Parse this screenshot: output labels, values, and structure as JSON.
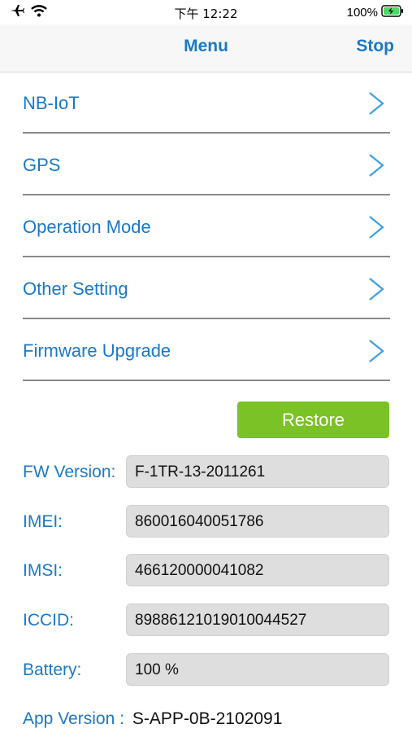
{
  "status_bar": {
    "time": "下午 12:22",
    "battery_percent": "100%",
    "icons": [
      "airplane-icon",
      "wifi-icon",
      "battery-charging-icon"
    ]
  },
  "nav": {
    "title": "Menu",
    "stop_label": "Stop"
  },
  "menu": {
    "items": [
      {
        "label": "NB-IoT"
      },
      {
        "label": "GPS"
      },
      {
        "label": "Operation Mode"
      },
      {
        "label": "Other Setting"
      },
      {
        "label": "Firmware Upgrade"
      }
    ]
  },
  "restore_label": "Restore",
  "info": {
    "fw_version": {
      "label": "FW Version:",
      "value": "F-1TR-13-2011261"
    },
    "imei": {
      "label": "IMEI:",
      "value": "860016040051786"
    },
    "imsi": {
      "label": "IMSI:",
      "value": "466120000041082"
    },
    "iccid": {
      "label": "ICCID:",
      "value": "89886121019010044527"
    },
    "battery": {
      "label": "Battery:",
      "value": "100 %"
    }
  },
  "app_version": {
    "label": "App Version :",
    "value": "S-APP-0B-2102091"
  },
  "colors": {
    "accent": "#1a78c8",
    "restore_button": "#7ac225",
    "field_bg": "#dedede",
    "battery_green": "#4cd964"
  }
}
